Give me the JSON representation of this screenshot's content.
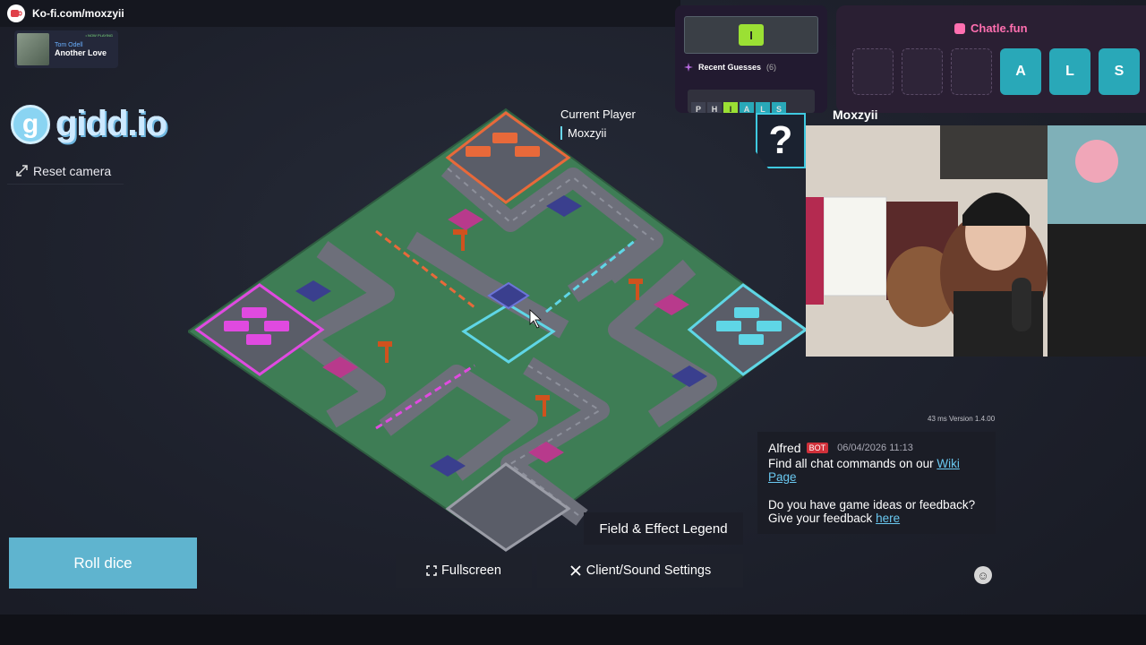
{
  "kofi": {
    "url": "Ko-fi.com/moxzyii"
  },
  "music": {
    "artist": "Tom Odell",
    "title": "Another Love",
    "tag": "• NOW PLAYING"
  },
  "logo": {
    "mark": "g",
    "text": "gidd.io"
  },
  "camera": {
    "reset_label": "Reset camera"
  },
  "current_player": {
    "label": "Current Player",
    "name": "Moxzyii"
  },
  "wordle": {
    "current_letter": "I",
    "recent_label": "Recent Guesses",
    "recent_count": "(6)",
    "recent_letters": [
      "P",
      "H",
      "I",
      "A",
      "L",
      "S"
    ]
  },
  "chatle": {
    "title": "Chatle.fun",
    "cells": [
      "",
      "",
      "",
      "A",
      "L",
      "S"
    ]
  },
  "stream": {
    "name": "Moxzyii",
    "question_mark": "?"
  },
  "chat": {
    "meta": "43 ms Version 1.4.00",
    "author": "Alfred",
    "badge": "BOT",
    "time": "06/04/2026 11:13",
    "line1_prefix": "Find all chat commands on our ",
    "line1_link": "Wiki Page",
    "line2_prefix": "Do you have game ideas or feedback? Give your feedback ",
    "line2_link": "here"
  },
  "controls": {
    "roll_dice": "Roll dice",
    "legend": "Field & Effect Legend",
    "fullscreen": "Fullscreen",
    "settings": "Client/Sound Settings"
  },
  "colors": {
    "roll_button": "#5fb4cf",
    "player_orange": "#e8693a",
    "player_magenta": "#e04ae0",
    "player_cyan": "#5fd6e6",
    "board_green": "#3e7d55",
    "road_gray": "#6d6f7a"
  }
}
